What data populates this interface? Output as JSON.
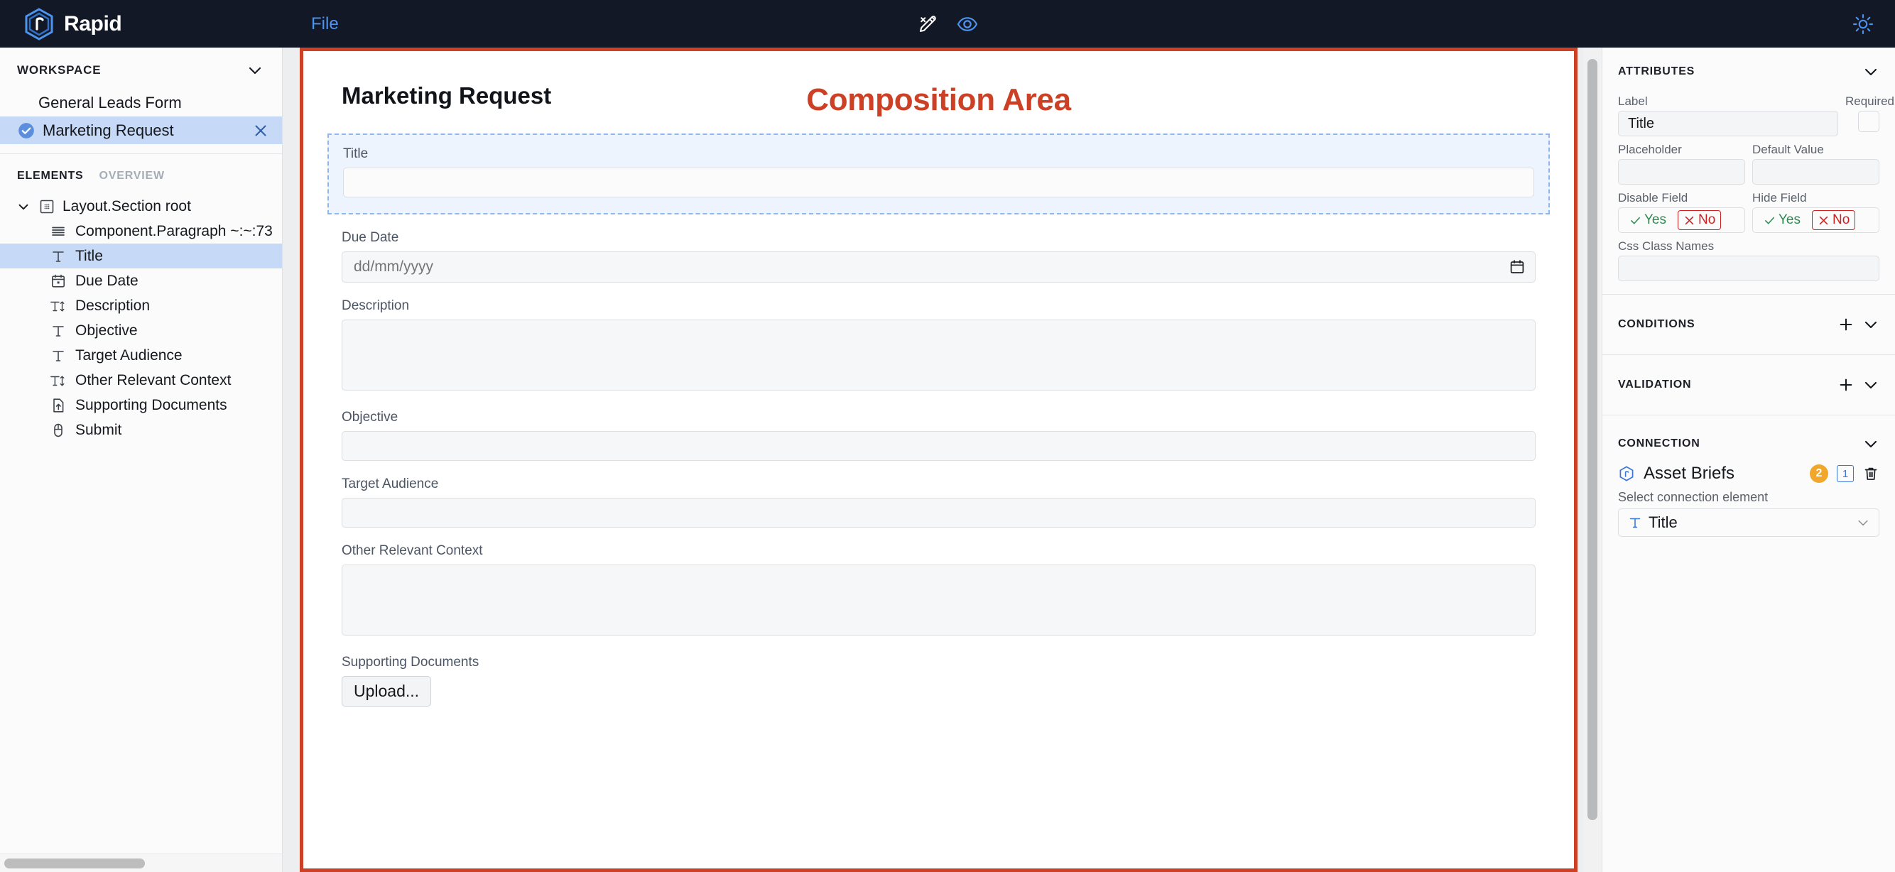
{
  "app": {
    "brand": "Rapid",
    "menu": {
      "file": "File"
    },
    "icons": {
      "logo": "rapid-hexagon-logo",
      "edit": "pencil-edit-icon",
      "preview": "eye-preview-icon",
      "theme": "sun-light-mode-icon"
    },
    "colors": {
      "topbar_bg": "#121826",
      "accent_blue": "#4d94ef",
      "annotation_red": "#cc4125",
      "selected_blue": "#c6d9f7",
      "badge_orange": "#f0a72b"
    }
  },
  "sidebar": {
    "workspace": {
      "title": "WORKSPACE",
      "items": [
        {
          "label": "General Leads Form",
          "selected": false
        },
        {
          "label": "Marketing Request",
          "selected": true
        }
      ]
    },
    "elements": {
      "tab_elements": "ELEMENTS",
      "tab_overview": "OVERVIEW",
      "tree": [
        {
          "label": "Layout.Section root",
          "icon": "layout-section-icon",
          "root": true,
          "selected": false
        },
        {
          "label": "Component.Paragraph ~:~:73",
          "icon": "paragraph-icon",
          "root": false,
          "selected": false
        },
        {
          "label": "Title",
          "icon": "text-field-icon",
          "root": false,
          "selected": true
        },
        {
          "label": "Due Date",
          "icon": "calendar-icon",
          "root": false,
          "selected": false
        },
        {
          "label": "Description",
          "icon": "textarea-icon",
          "root": false,
          "selected": false
        },
        {
          "label": "Objective",
          "icon": "text-field-icon",
          "root": false,
          "selected": false
        },
        {
          "label": "Target Audience",
          "icon": "text-field-icon",
          "root": false,
          "selected": false
        },
        {
          "label": "Other Relevant Context",
          "icon": "textarea-icon",
          "root": false,
          "selected": false
        },
        {
          "label": "Supporting Documents",
          "icon": "file-upload-icon",
          "root": false,
          "selected": false
        },
        {
          "label": "Submit",
          "icon": "submit-button-icon",
          "root": false,
          "selected": false
        }
      ]
    }
  },
  "canvas": {
    "annotation": "Composition Area",
    "form_title": "Marketing Request",
    "fields": {
      "title": {
        "label": "Title",
        "value": "",
        "selected": true
      },
      "due_date": {
        "label": "Due Date",
        "placeholder": "dd/mm/yyyy",
        "value": ""
      },
      "description": {
        "label": "Description",
        "value": ""
      },
      "objective": {
        "label": "Objective",
        "value": ""
      },
      "target_audience": {
        "label": "Target Audience",
        "value": ""
      },
      "other_context": {
        "label": "Other Relevant Context",
        "value": ""
      },
      "supporting_documents": {
        "label": "Supporting Documents",
        "button": "Upload..."
      }
    }
  },
  "right_panel": {
    "attributes": {
      "title": "ATTRIBUTES",
      "label_label": "Label",
      "label_value": "Title",
      "required_label": "Required",
      "required_checked": false,
      "placeholder_label": "Placeholder",
      "placeholder_value": "",
      "default_value_label": "Default Value",
      "default_value_value": "",
      "disable_field_label": "Disable Field",
      "hide_field_label": "Hide Field",
      "yes": "Yes",
      "no": "No",
      "disable_field_selected": "No",
      "hide_field_selected": "No",
      "css_class_label": "Css Class Names",
      "css_class_value": ""
    },
    "conditions": {
      "title": "CONDITIONS"
    },
    "validation": {
      "title": "VALIDATION"
    },
    "connection": {
      "title": "CONNECTION",
      "name": "Asset Briefs",
      "badge_orange": "2",
      "badge_blue": "1",
      "select_label": "Select connection element",
      "selected_element": "Title"
    }
  }
}
